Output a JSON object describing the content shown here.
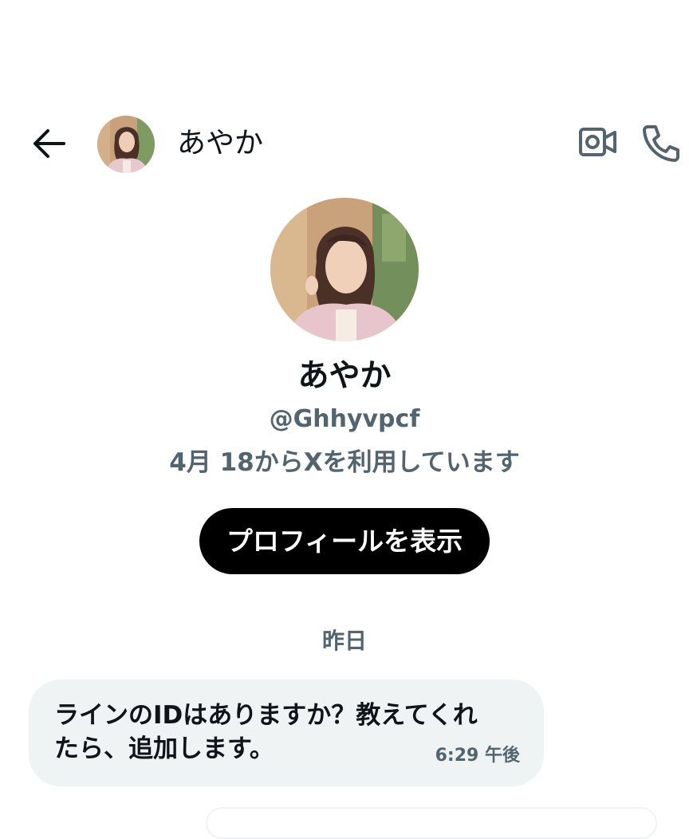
{
  "header": {
    "back_icon": "arrow-left-icon",
    "name": "あやか",
    "video_icon": "video-camera-icon",
    "call_icon": "phone-icon"
  },
  "profile": {
    "name": "あやか",
    "handle": "@Ghhyvpcf",
    "joined": "4月 18からXを利用しています",
    "view_profile_label": "プロフィールを表示"
  },
  "conversation": {
    "date_divider": "昨日",
    "messages": [
      {
        "text": "ラインのIDはありますか？教えてくれ\nたら、追加します。",
        "time": "6:29 午後"
      }
    ]
  },
  "colors": {
    "text_primary": "#0f1419",
    "text_secondary": "#536471",
    "bubble_background": "#eff3f4",
    "button_background": "#000000",
    "button_text": "#ffffff"
  }
}
